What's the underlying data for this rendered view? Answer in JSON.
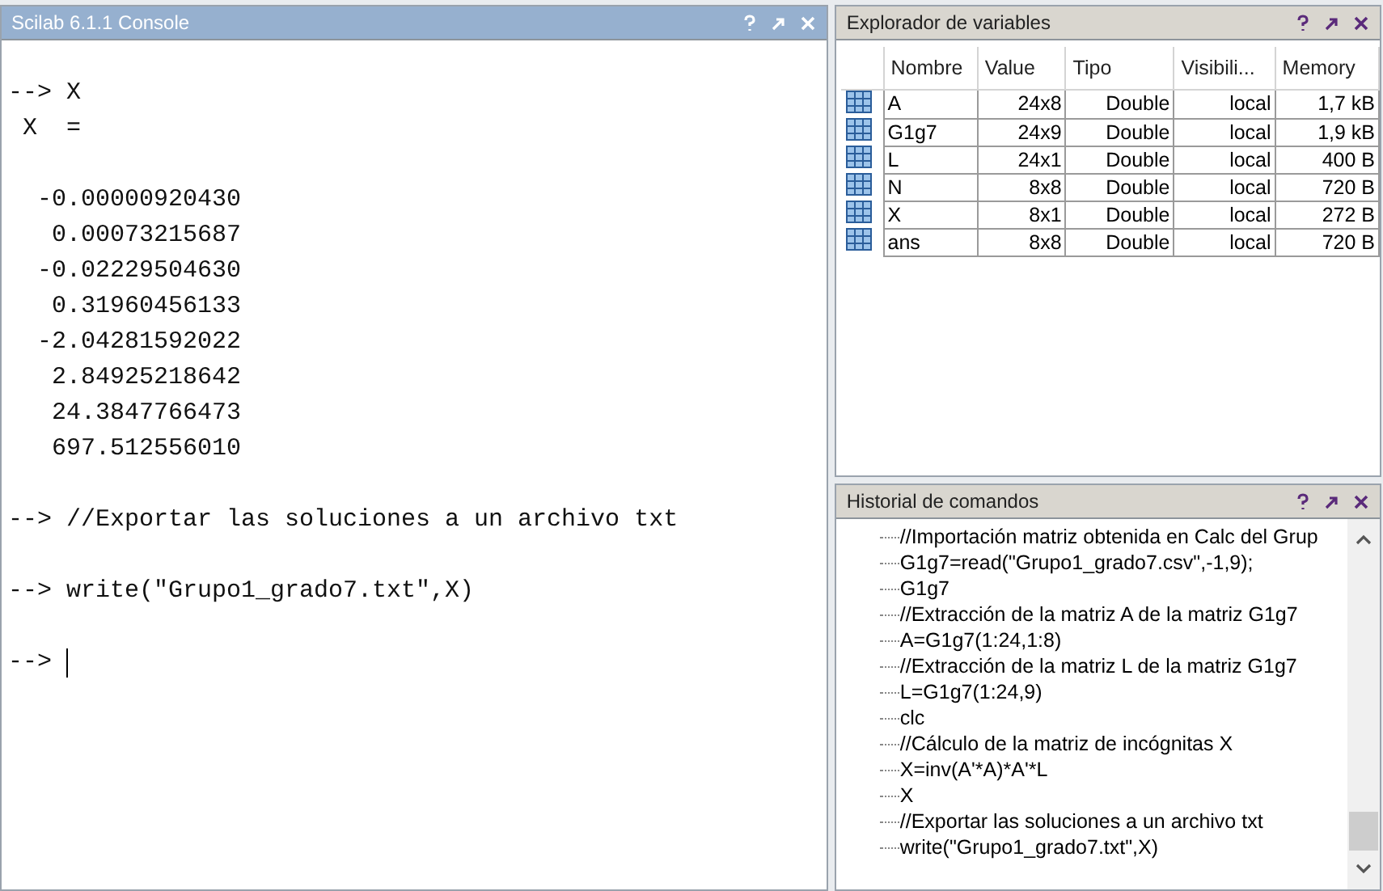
{
  "console": {
    "title": "Scilab 6.1.1 Console",
    "blocks": [
      [
        "--> X",
        " X  ="
      ],
      [
        "  -0.00000920430",
        "   0.00073215687",
        "  -0.02229504630",
        "   0.31960456133",
        "  -2.04281592022",
        "   2.84925218642",
        "   24.3847766473",
        "   697.512556010"
      ],
      [
        "--> //Exportar las soluciones a un archivo txt"
      ],
      [
        "--> write(\"Grupo1_grado7.txt\",X)"
      ]
    ],
    "prompt": "--> "
  },
  "variables": {
    "title": "Explorador de variables",
    "columns": [
      "Nombre",
      "Value",
      "Tipo",
      "Visibili...",
      "Memory"
    ],
    "rows": [
      [
        "A",
        "24x8",
        "Double",
        "local",
        "1,7 kB"
      ],
      [
        "G1g7",
        "24x9",
        "Double",
        "local",
        "1,9 kB"
      ],
      [
        "L",
        "24x1",
        "Double",
        "local",
        "400 B"
      ],
      [
        "N",
        "8x8",
        "Double",
        "local",
        "720 B"
      ],
      [
        "X",
        "8x1",
        "Double",
        "local",
        "272 B"
      ],
      [
        "ans",
        "8x8",
        "Double",
        "local",
        "720 B"
      ]
    ]
  },
  "history": {
    "title": "Historial de comandos",
    "items": [
      "//Importación matriz obtenida en Calc del Grup",
      "G1g7=read(\"Grupo1_grado7.csv\",-1,9);",
      "G1g7",
      "//Extracción de la matriz A de la matriz G1g7",
      "A=G1g7(1:24,1:8)",
      "//Extracción de la matriz L de la matriz G1g7",
      "L=G1g7(1:24,9)",
      "clc",
      "//Cálculo de la matriz de incógnitas X",
      "X=inv(A'*A)*A'*L",
      "X",
      "//Exportar las soluciones a un archivo txt",
      "write(\"Grupo1_grado7.txt\",X)"
    ]
  }
}
